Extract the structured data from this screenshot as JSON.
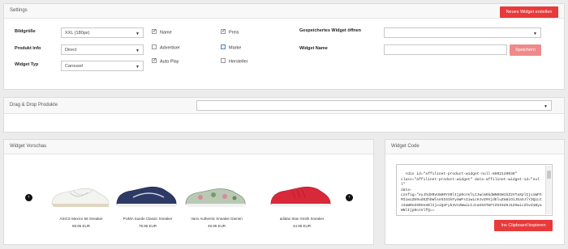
{
  "settings": {
    "title": "Settings",
    "new_widget_button": "Neues Widget erstellen",
    "bildgroesse_label": "Bildgröße",
    "bildgroesse_value": "XXL (180px)",
    "produkt_info_label": "Produkt Info",
    "produkt_info_value": "Direct",
    "widget_typ_label": "Widget Typ",
    "widget_typ_value": "Carousel",
    "checkboxes": {
      "name": {
        "label": "Name",
        "checked": true
      },
      "preis": {
        "label": "Preis",
        "checked": true
      },
      "advertiser": {
        "label": "Advertiser",
        "checked": false
      },
      "marke": {
        "label": "Marke",
        "checked": false
      },
      "auto_play": {
        "label": "Auto Play",
        "checked": true
      },
      "hersteller": {
        "label": "Hersteller",
        "checked": false
      }
    },
    "gespeichertes_label": "Gespeichertes Widget öffnen",
    "gespeichertes_value": "",
    "widget_name_label": "Widget Name",
    "widget_name_value": "",
    "speichern_button": "Speichern"
  },
  "dragdrop": {
    "title": "Drag & Drop Produkte",
    "select_value": ""
  },
  "preview": {
    "title": "Widget Vorschau",
    "products": [
      {
        "name": "ASICS Mexico 66 Sneaker",
        "price": "69.95 EUR"
      },
      {
        "name": "PUMA Suede Classic Sneaker",
        "price": "79.95 EUR"
      },
      {
        "name": "Vans Authentic Sneaker Damen",
        "price": "49.95 EUR"
      },
      {
        "name": "adidas Stan Smith Sneaker",
        "price": "44.95 EUR"
      }
    ]
  },
  "widget_code": {
    "title": "Widget Code",
    "code": "<div id=\"affilinet-product-widget-null-8802149038\"\nclass=\"affilinet-product-widget\" data-affilinet-widget-id=\"null\"\ndata-\nconfig=\"eyJhdXRvUm90YXRlIjp0cnVlLCJwcm9kdWN0SW1hZ2VTaXplIjoiWFhMIiwiZm9udEZhbWlseSI6IkFyaWFsIiwicHJvZHVjdEluZm8iOiJEaXJlY3QiLCJ3aWRnZXRUeXBlIjoiQ2Fyb3VzZWwiLCJzaG93TmFtZSI6dHJ1ZSwic2hvd1ByaWNlIjp0cnVlfQ==",
    "clipboard_button": "Ins Clipboard kopieren"
  },
  "colors": {
    "accent": "#e8393b",
    "accent_light": "#ef8a8a"
  }
}
